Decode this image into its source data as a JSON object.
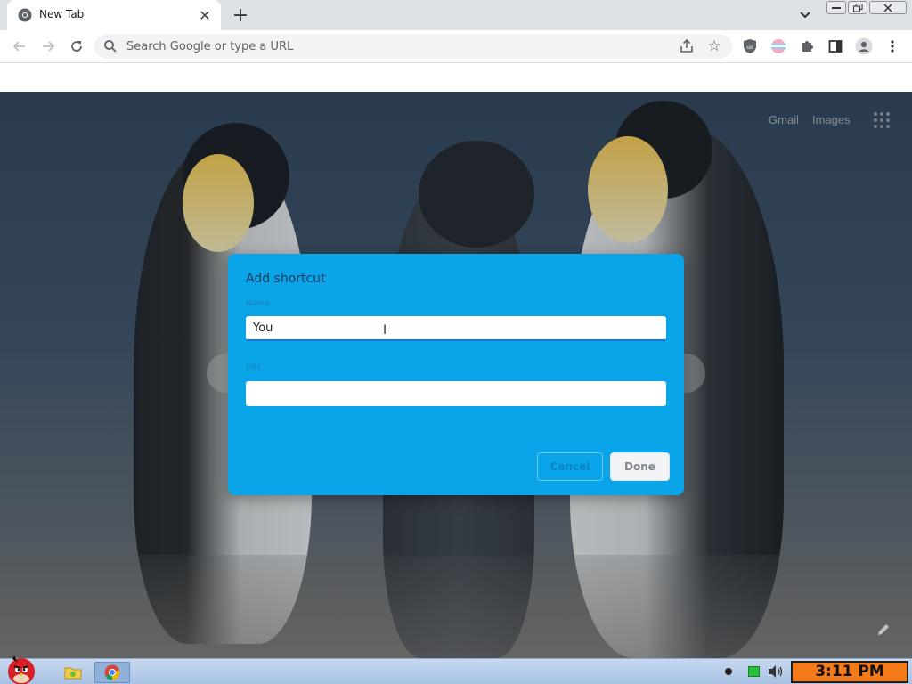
{
  "browser": {
    "tab": {
      "title": "New Tab"
    },
    "omnibox": {
      "placeholder": "Search Google or type a URL",
      "value": ""
    }
  },
  "ntp": {
    "gmail_label": "Gmail",
    "images_label": "Images"
  },
  "dialog": {
    "title": "Add shortcut",
    "name_label": "Name",
    "name_value": "You",
    "url_label": "URL",
    "url_value": "",
    "cancel_label": "Cancel",
    "done_label": "Done",
    "accent_color": "#0aa5e8"
  },
  "taskbar": {
    "clock": "3:11 PM"
  },
  "colors": {
    "tabstrip": "#dee1e6",
    "clock_bg": "#f47a1a"
  }
}
